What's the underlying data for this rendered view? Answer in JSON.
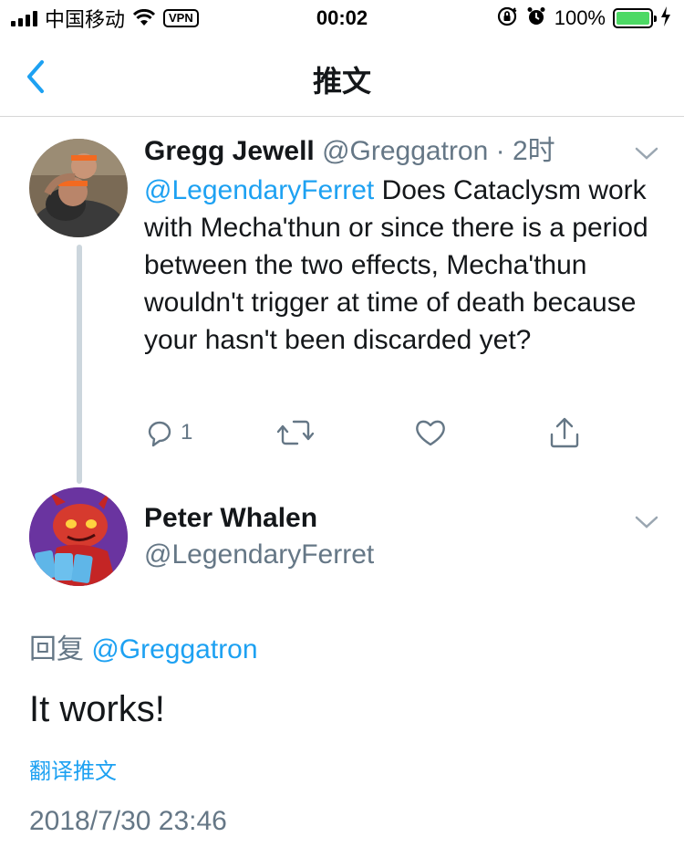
{
  "status_bar": {
    "carrier": "中国移动",
    "vpn": "VPN",
    "time": "00:02",
    "battery_pct": "100%",
    "battery_level": 1.0,
    "icons": [
      "signal-icon",
      "wifi-icon",
      "orientation-lock-icon",
      "alarm-icon",
      "battery-icon",
      "charging-icon"
    ]
  },
  "nav": {
    "back_icon": "chevron-left-icon",
    "title": "推文"
  },
  "parent_tweet": {
    "name": "Gregg Jewell",
    "handle": "@Greggatron",
    "separator": "·",
    "time": "2时",
    "mention": "@LegendaryFerret",
    "text": " Does Cataclysm work with Mecha'thun or since there is a period between the two effects, Mecha'thun wouldn't trigger at time of death because your hasn't been discarded yet?",
    "actions": {
      "reply_count": "1",
      "icons": [
        "reply-icon",
        "retweet-icon",
        "like-icon",
        "share-icon"
      ]
    }
  },
  "focus_tweet": {
    "name": "Peter Whalen",
    "handle": "@LegendaryFerret",
    "reply_prefix": "回复",
    "reply_mention": "@Greggatron",
    "text": "It works!",
    "translate_label": "翻译推文",
    "timestamp": "2018/7/30 23:46"
  },
  "colors": {
    "accent": "#1da1f2",
    "secondary_text": "#657786",
    "primary_text": "#14171a",
    "thread_line": "#ccd6dd",
    "battery_fill": "#4cd964"
  }
}
